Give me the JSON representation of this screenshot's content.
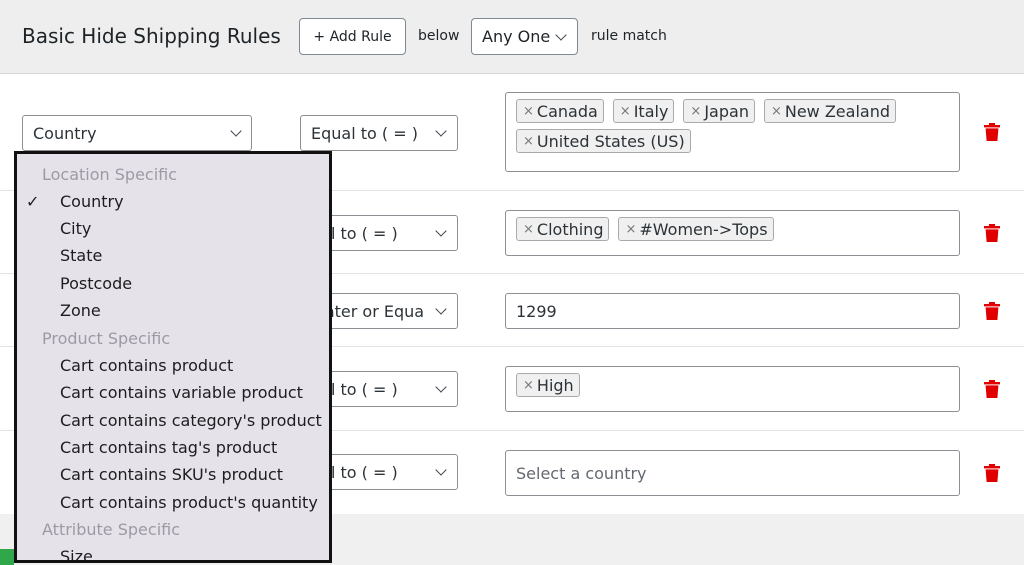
{
  "header": {
    "title": "Basic Hide Shipping Rules",
    "add_rule_label": "+ Add Rule",
    "below_label": "below",
    "match_value": "Any One",
    "rule_match_label": "rule match"
  },
  "rules": [
    {
      "condition": "Country",
      "operator": "Equal to ( = )",
      "tags": [
        "Canada",
        "Italy",
        "Japan",
        "New Zealand",
        "United States (US)"
      ]
    },
    {
      "condition": "",
      "operator": "ual to ( = )",
      "tags": [
        "Clothing",
        "#Women->Tops"
      ]
    },
    {
      "condition": "",
      "operator": "eater or Equa",
      "value": "1299"
    },
    {
      "condition": "",
      "operator": "ual to ( = )",
      "tags": [
        "High"
      ]
    },
    {
      "condition": "",
      "operator": "ual to ( = )",
      "placeholder": "Select a country"
    }
  ],
  "dropdown": {
    "groups": [
      {
        "label": "Location Specific",
        "items": [
          "Country",
          "City",
          "State",
          "Postcode",
          "Zone"
        ]
      },
      {
        "label": "Product Specific",
        "items": [
          "Cart contains product",
          "Cart contains variable product",
          "Cart contains category's product",
          "Cart contains tag's product",
          "Cart contains SKU's product",
          "Cart contains product's quantity"
        ]
      },
      {
        "label": "Attribute Specific",
        "items": [
          "Size"
        ]
      }
    ],
    "selected": "Country",
    "check_glyph": "✓"
  },
  "icons": {
    "tag_remove": "×",
    "delete": "trash-icon"
  },
  "colors": {
    "delete_red": "#e00000",
    "accent_green": "#2ea84a"
  }
}
